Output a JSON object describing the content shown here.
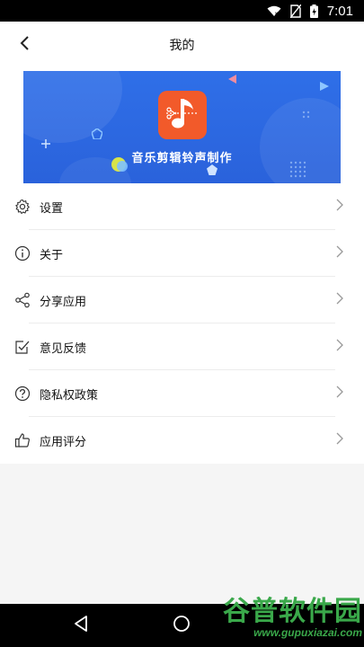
{
  "status_bar": {
    "time": "7:01",
    "icons": [
      "wifi-icon",
      "no-sim-icon",
      "battery-charging-icon"
    ]
  },
  "app_bar": {
    "title": "我的",
    "back_icon": "chevron-left-icon"
  },
  "banner": {
    "app_name": "音乐剪辑铃声制作",
    "logo_icon": "music-note-scissors-icon",
    "colors": {
      "background": "#2f6fe8",
      "logo": "#f25a2a"
    }
  },
  "menu": {
    "items": [
      {
        "label": "设置",
        "icon": "gear-icon"
      },
      {
        "label": "关于",
        "icon": "info-icon"
      },
      {
        "label": "分享应用",
        "icon": "share-icon"
      },
      {
        "label": "意见反馈",
        "icon": "feedback-icon"
      },
      {
        "label": "隐私权政策",
        "icon": "question-icon"
      },
      {
        "label": "应用评分",
        "icon": "thumbs-up-icon"
      }
    ],
    "chevron_icon": "chevron-right-icon"
  },
  "nav_bar": {
    "buttons": [
      "back-triangle-icon",
      "home-circle-icon"
    ]
  },
  "watermark": {
    "name": "谷普软件园",
    "url": "www.gupuxiazai.com"
  }
}
